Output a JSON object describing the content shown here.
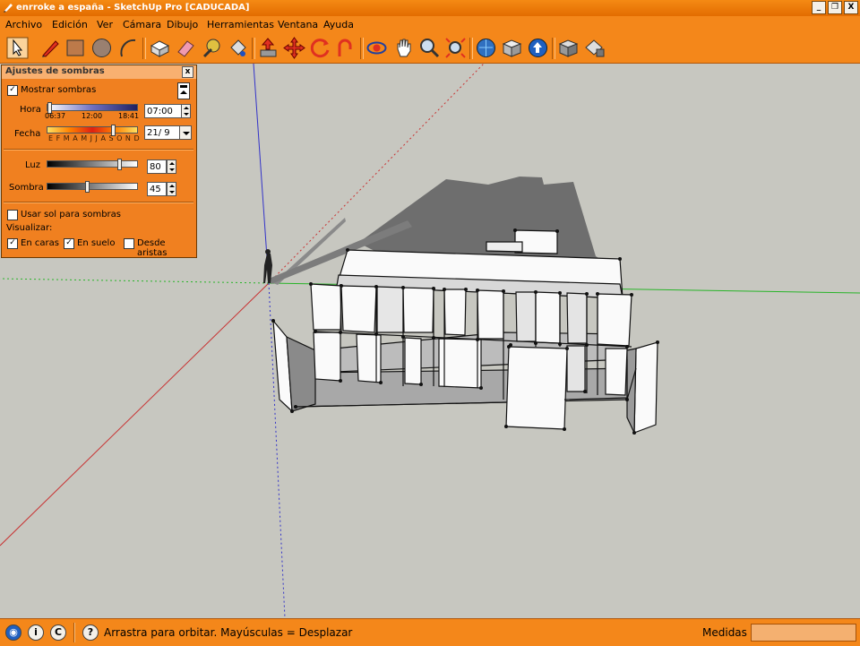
{
  "window": {
    "title": "enrroke a españa - SketchUp Pro [CADUCADA]",
    "controls": [
      "_",
      "❐",
      "X"
    ]
  },
  "menu": [
    "Archivo",
    "Edición",
    "Ver",
    "Cámara",
    "Dibujo",
    "Herramientas",
    "Ventana",
    "Ayuda"
  ],
  "toolbar": {
    "tools": [
      "select-tool-icon",
      "pencil-tool-icon",
      "rectangle-tool-icon",
      "circle-tool-icon",
      "arc-tool-icon",
      "make-component-icon",
      "eraser-icon",
      "tape-measure-icon",
      "paint-bucket-icon",
      "push-pull-icon",
      "move-icon",
      "rotate-icon",
      "follow-me-icon",
      "orbit-icon",
      "pan-icon",
      "zoom-icon",
      "zoom-extents-icon",
      "get-models-icon",
      "share-model-icon",
      "google-earth-icon",
      "components-icon",
      "materials-icon"
    ]
  },
  "shadow_panel": {
    "title": "Ajustes de sombras",
    "close_label": "x",
    "show_shadows": {
      "label": "Mostrar sombras",
      "checked": true
    },
    "hora": {
      "label": "Hora",
      "start": "06:37",
      "mid": "12:00",
      "end": "18:41",
      "value": "07:00",
      "slider_fraction": 0.03
    },
    "fecha": {
      "label": "Fecha",
      "months": "E F M A M J J A S O N D",
      "value": "21/ 9",
      "slider_fraction": 0.72
    },
    "luz": {
      "label": "Luz",
      "value": "80",
      "slider_fraction": 0.8
    },
    "sombra": {
      "label": "Sombra",
      "value": "45",
      "slider_fraction": 0.45
    },
    "use_sun": {
      "label": "Usar sol para sombras",
      "checked": false
    },
    "visualizar_label": "Visualizar:",
    "on_faces": {
      "label": "En caras",
      "checked": true
    },
    "on_ground": {
      "label": "En suelo",
      "checked": true
    },
    "from_edges": {
      "label": "Desde aristas",
      "checked": false
    }
  },
  "status": {
    "hint": "Arrastra para orbitar. Mayúsculas = Desplazar",
    "measure_label": "Medidas",
    "measure_value": ""
  },
  "colors": {
    "accent": "#f4871a",
    "canvas": "#c7c7c0",
    "axis_red": "#c83232",
    "axis_green": "#28b428",
    "axis_blue": "#3232c8"
  }
}
